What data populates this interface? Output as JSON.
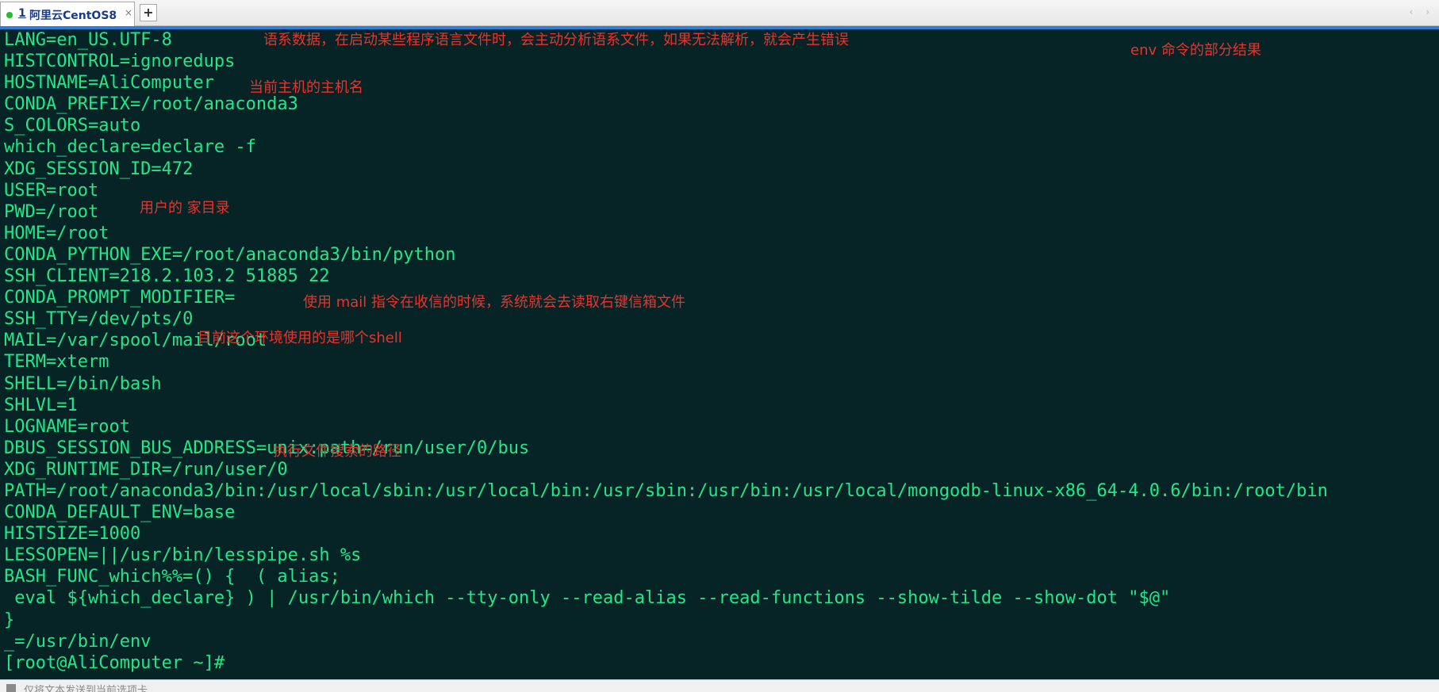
{
  "tab": {
    "index": "1",
    "label": "阿里云CentOS8",
    "close": "×",
    "add": "+",
    "arrows": "‹ ›"
  },
  "terminal": {
    "lines": [
      "LANG=en_US.UTF-8",
      "HISTCONTROL=ignoredups",
      "HOSTNAME=AliComputer",
      "CONDA_PREFIX=/root/anaconda3",
      "S_COLORS=auto",
      "which_declare=declare -f",
      "XDG_SESSION_ID=472",
      "USER=root",
      "PWD=/root",
      "HOME=/root",
      "CONDA_PYTHON_EXE=/root/anaconda3/bin/python",
      "SSH_CLIENT=218.2.103.2 51885 22",
      "CONDA_PROMPT_MODIFIER=",
      "SSH_TTY=/dev/pts/0",
      "MAIL=/var/spool/mail/root",
      "TERM=xterm",
      "SHELL=/bin/bash",
      "SHLVL=1",
      "LOGNAME=root",
      "DBUS_SESSION_BUS_ADDRESS=unix:path=/run/user/0/bus",
      "XDG_RUNTIME_DIR=/run/user/0",
      "PATH=/root/anaconda3/bin:/usr/local/sbin:/usr/local/bin:/usr/sbin:/usr/bin:/usr/local/mongodb-linux-x86_64-4.0.6/bin:/root/bin",
      "CONDA_DEFAULT_ENV=base",
      "HISTSIZE=1000",
      "LESSOPEN=||/usr/bin/lesspipe.sh %s",
      "BASH_FUNC_which%%=() {  ( alias;",
      " eval ${which_declare} ) | /usr/bin/which --tty-only --read-alias --read-functions --show-tilde --show-dot \"$@\"",
      "}",
      "_=/usr/bin/env",
      "[root@AliComputer ~]#"
    ]
  },
  "annotations": {
    "lang": "语系数据，在启动某些程序语言文件时，会主动分析语系文件，如果无法解析，就会产生错误",
    "env": "env 命令的部分结果",
    "hostname": "当前主机的主机名",
    "home": "用户的 家目录",
    "mail": "使用 mail 指令在收信的时候，系统就会去读取右键信箱文件",
    "shell": "目前这个环境使用的是哪个shell",
    "path": "执行文件搜索的路径"
  },
  "statusbar": {
    "text": "仅将文本发送到当前选项卡"
  },
  "colors": {
    "terminal_bg": "#062326",
    "terminal_fg": "#1ee88a",
    "annotation": "#e8342c",
    "accent": "#2b7fd6"
  }
}
